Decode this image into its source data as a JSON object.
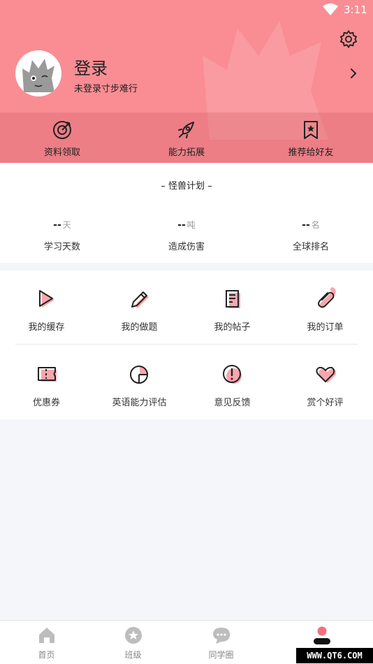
{
  "status_bar": {
    "time": "3:11"
  },
  "profile": {
    "title": "登录",
    "subtitle": "未登录寸步难行"
  },
  "quick_actions": [
    {
      "label": "资料领取",
      "icon": "target-icon"
    },
    {
      "label": "能力拓展",
      "icon": "rocket-icon"
    },
    {
      "label": "推荐给好友",
      "icon": "bookmark-star-icon"
    }
  ],
  "plan": {
    "title": "– 怪兽计划 –",
    "stats": [
      {
        "value": "--",
        "unit": "天",
        "label": "学习天数"
      },
      {
        "value": "--",
        "unit": "吨",
        "label": "造成伤害"
      },
      {
        "value": "--",
        "unit": "名",
        "label": "全球排名"
      }
    ]
  },
  "menu": [
    {
      "label": "我的缓存",
      "icon": "play-icon"
    },
    {
      "label": "我的做题",
      "icon": "pencil-icon"
    },
    {
      "label": "我的帖子",
      "icon": "document-icon"
    },
    {
      "label": "我的订单",
      "icon": "paperclip-icon"
    },
    {
      "label": "优惠券",
      "icon": "ticket-icon"
    },
    {
      "label": "英语能力评估",
      "icon": "pie-chart-icon"
    },
    {
      "label": "意见反馈",
      "icon": "exclamation-icon"
    },
    {
      "label": "赏个好评",
      "icon": "heart-icon"
    }
  ],
  "tabs": [
    {
      "label": "首页",
      "icon": "home-icon"
    },
    {
      "label": "班级",
      "icon": "star-icon"
    },
    {
      "label": "同学圈",
      "icon": "chat-icon"
    },
    {
      "label": "",
      "icon": "profile-icon",
      "active": true
    }
  ],
  "colors": {
    "accent": "#f98d93",
    "accent_dark": "#f0717d",
    "icon_fill": "#f9a6ad"
  },
  "watermark": "WWW.QT6.COM"
}
